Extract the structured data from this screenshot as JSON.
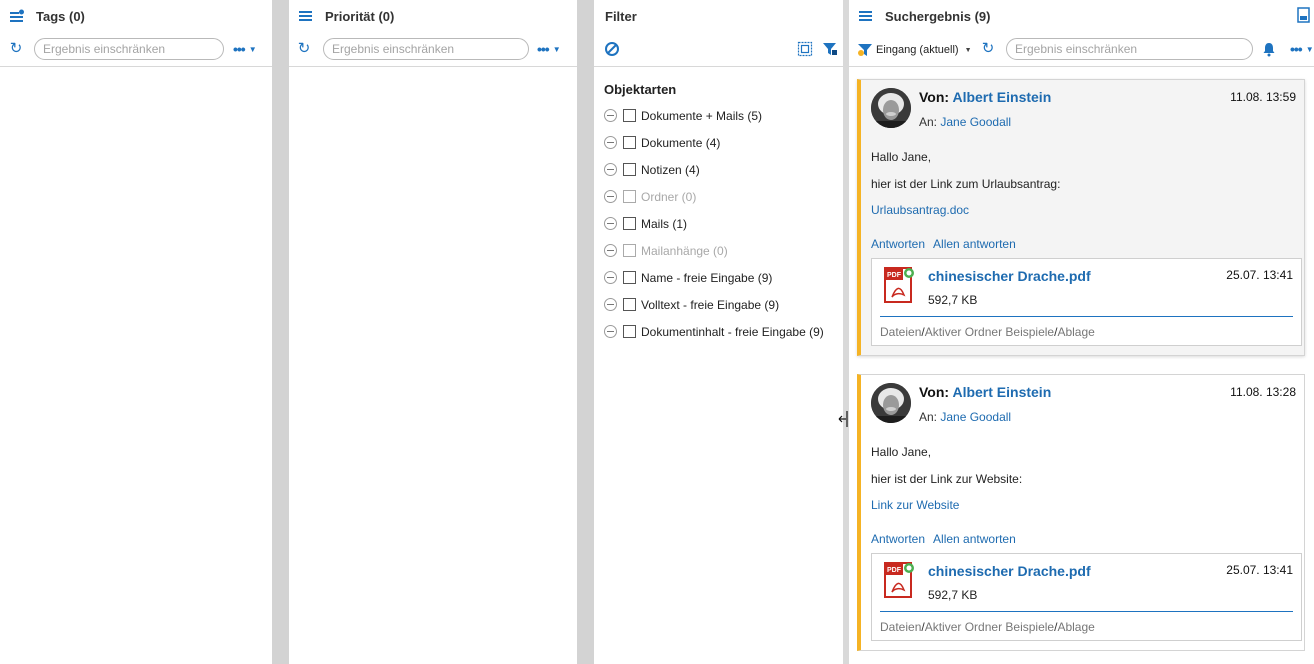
{
  "tags_panel": {
    "title": "Tags (0)",
    "search_placeholder": "Ergebnis einschränken"
  },
  "priority_panel": {
    "title": "Priorität (0)",
    "search_placeholder": "Ergebnis einschränken"
  },
  "filter_panel": {
    "title": "Filter",
    "section_title": "Objektarten",
    "items": [
      {
        "label": "Dokumente + Mails (5)",
        "enabled": true
      },
      {
        "label": "Dokumente (4)",
        "enabled": true
      },
      {
        "label": "Notizen (4)",
        "enabled": true
      },
      {
        "label": "Ordner (0)",
        "enabled": false
      },
      {
        "label": "Mails (1)",
        "enabled": true
      },
      {
        "label": "Mailanhänge (0)",
        "enabled": false
      },
      {
        "label": "Name - freie Eingabe (9)",
        "enabled": true
      },
      {
        "label": "Volltext - freie Eingabe (9)",
        "enabled": true
      },
      {
        "label": "Dokumentinhalt - freie Eingabe (9)",
        "enabled": true
      }
    ]
  },
  "result_panel": {
    "title": "Suchergebnis (9)",
    "inbox_label": "Eingang (aktuell)",
    "search_placeholder": "Ergebnis einschränken",
    "cards": [
      {
        "from_label": "Von:",
        "from_name": "Albert Einstein",
        "date": "11.08. 13:59",
        "to_label": "An:",
        "to_name": "Jane Goodall",
        "greeting": "Hallo Jane,",
        "text": "hier ist der Link zum Urlaubsantrag:",
        "link": "Urlaubsantrag.doc",
        "reply": "Antworten",
        "reply_all": "Allen antworten",
        "attachment": {
          "name": "chinesischer Drache.pdf",
          "date": "25.07. 13:41",
          "size": "592,7 KB",
          "path": [
            "Dateien",
            "Aktiver Ordner Beispiele",
            "Ablage"
          ]
        }
      },
      {
        "from_label": "Von:",
        "from_name": "Albert Einstein",
        "date": "11.08. 13:28",
        "to_label": "An:",
        "to_name": "Jane Goodall",
        "greeting": "Hallo Jane,",
        "text": "hier ist der Link zur Website:",
        "link": "Link zur Website",
        "reply": "Antworten",
        "reply_all": "Allen antworten",
        "attachment": {
          "name": "chinesischer Drache.pdf",
          "date": "25.07. 13:41",
          "size": "592,7 KB",
          "path": [
            "Dateien",
            "Aktiver Ordner Beispiele",
            "Ablage"
          ]
        }
      }
    ]
  },
  "colors": {
    "accent": "#1e73c0",
    "card_stripe": "#f5b324",
    "pdf_red": "#c8291f",
    "badge_green": "#4caf50"
  }
}
